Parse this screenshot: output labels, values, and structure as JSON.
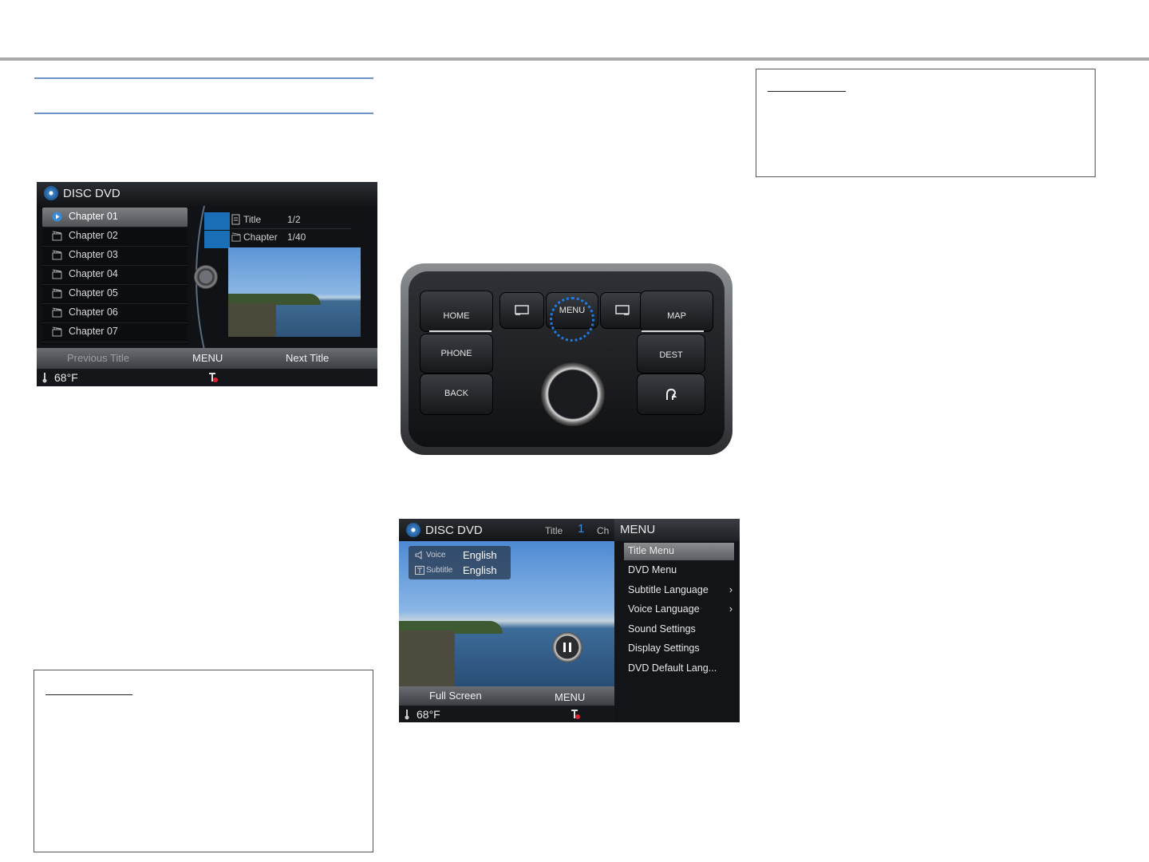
{
  "screen1": {
    "title": "DISC DVD",
    "chapters": [
      "Chapter 01",
      "Chapter 02",
      "Chapter 03",
      "Chapter 04",
      "Chapter 05",
      "Chapter 06",
      "Chapter 07"
    ],
    "info": {
      "title_label": "Title",
      "title_value": "1/2",
      "chapter_label": "Chapter",
      "chapter_value": "1/40"
    },
    "buttons": {
      "prev": "Previous Title",
      "menu": "MENU",
      "next": "Next Title"
    },
    "temperature": "68°F"
  },
  "control_panel": {
    "home": "HOME",
    "menu": "MENU",
    "map": "MAP",
    "phone": "PHONE",
    "dest": "DEST",
    "back": "BACK"
  },
  "screen2": {
    "title": "DISC DVD",
    "header_title_label": "Title",
    "header_title_value": "1",
    "header_partial": "Ch",
    "voice_label": "Voice",
    "voice_value": "English",
    "subtitle_label": "Subtitle",
    "subtitle_value": "English",
    "menu_header": "MENU",
    "menu_items": [
      "Title Menu",
      "DVD Menu",
      "Subtitle Language",
      "Voice Language",
      "Sound Settings",
      "Display Settings",
      "DVD Default Lang..."
    ],
    "buttons": {
      "full_screen": "Full Screen",
      "menu": "MENU"
    },
    "temperature": "68°F"
  }
}
